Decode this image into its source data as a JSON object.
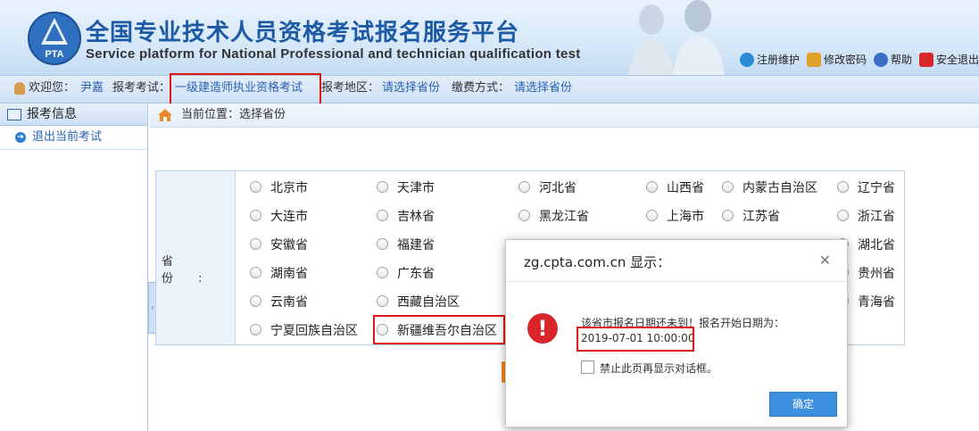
{
  "header": {
    "title_cn": "全国专业技术人员资格考试报名服务平台",
    "title_en": "Service platform for National Professional and technician qualification test",
    "logo_text": "PTA",
    "links": [
      {
        "label": "注册维护",
        "icon": "globe-icon",
        "color": "#2a8bd8"
      },
      {
        "label": "修改密码",
        "icon": "lock-icon",
        "color": "#e0a02a"
      },
      {
        "label": "帮助",
        "icon": "help-icon",
        "color": "#3b6fc7"
      },
      {
        "label": "安全退出",
        "icon": "power-icon",
        "color": "#d9262b"
      }
    ]
  },
  "infobar": {
    "welcome_label": "欢迎您：",
    "user_name": "尹嘉",
    "exam_label": "报考考试：",
    "exam_value": "一级建造师执业资格考试",
    "region_label": "报考地区：",
    "region_value": "请选择省份",
    "pay_label": "缴费方式：",
    "pay_value": "请选择省份"
  },
  "sidebar": {
    "header": "报考信息",
    "items": [
      {
        "label": "退出当前考试"
      }
    ]
  },
  "breadcrumb": {
    "text": "当前位置：选择省份"
  },
  "province_table": {
    "label": "省 份:",
    "rows": [
      [
        "北京市",
        "天津市",
        "河北省",
        "山西省",
        "内蒙古自治区",
        "辽宁省"
      ],
      [
        "大连市",
        "吉林省",
        "黑龙江省",
        "上海市",
        "江苏省",
        "浙江省"
      ],
      [
        "安徽省",
        "福建省",
        "",
        "",
        "",
        "湖北省"
      ],
      [
        "湖南省",
        "广东省",
        "",
        "",
        "",
        "贵州省"
      ],
      [
        "云南省",
        "西藏自治区",
        "",
        "",
        "",
        "青海省"
      ],
      [
        "宁夏回族自治区",
        "新疆维吾尔自治区",
        "",
        "",
        "",
        ""
      ]
    ]
  },
  "dialog": {
    "title": "zg.cpta.com.cn 显示：",
    "message_line1": "该省市报名日期还未到！报名开始日期为：",
    "message_line2": "2019-07-01 10:00:00",
    "checkbox_label": "禁止此页再显示对话框。",
    "ok_label": "确定"
  }
}
